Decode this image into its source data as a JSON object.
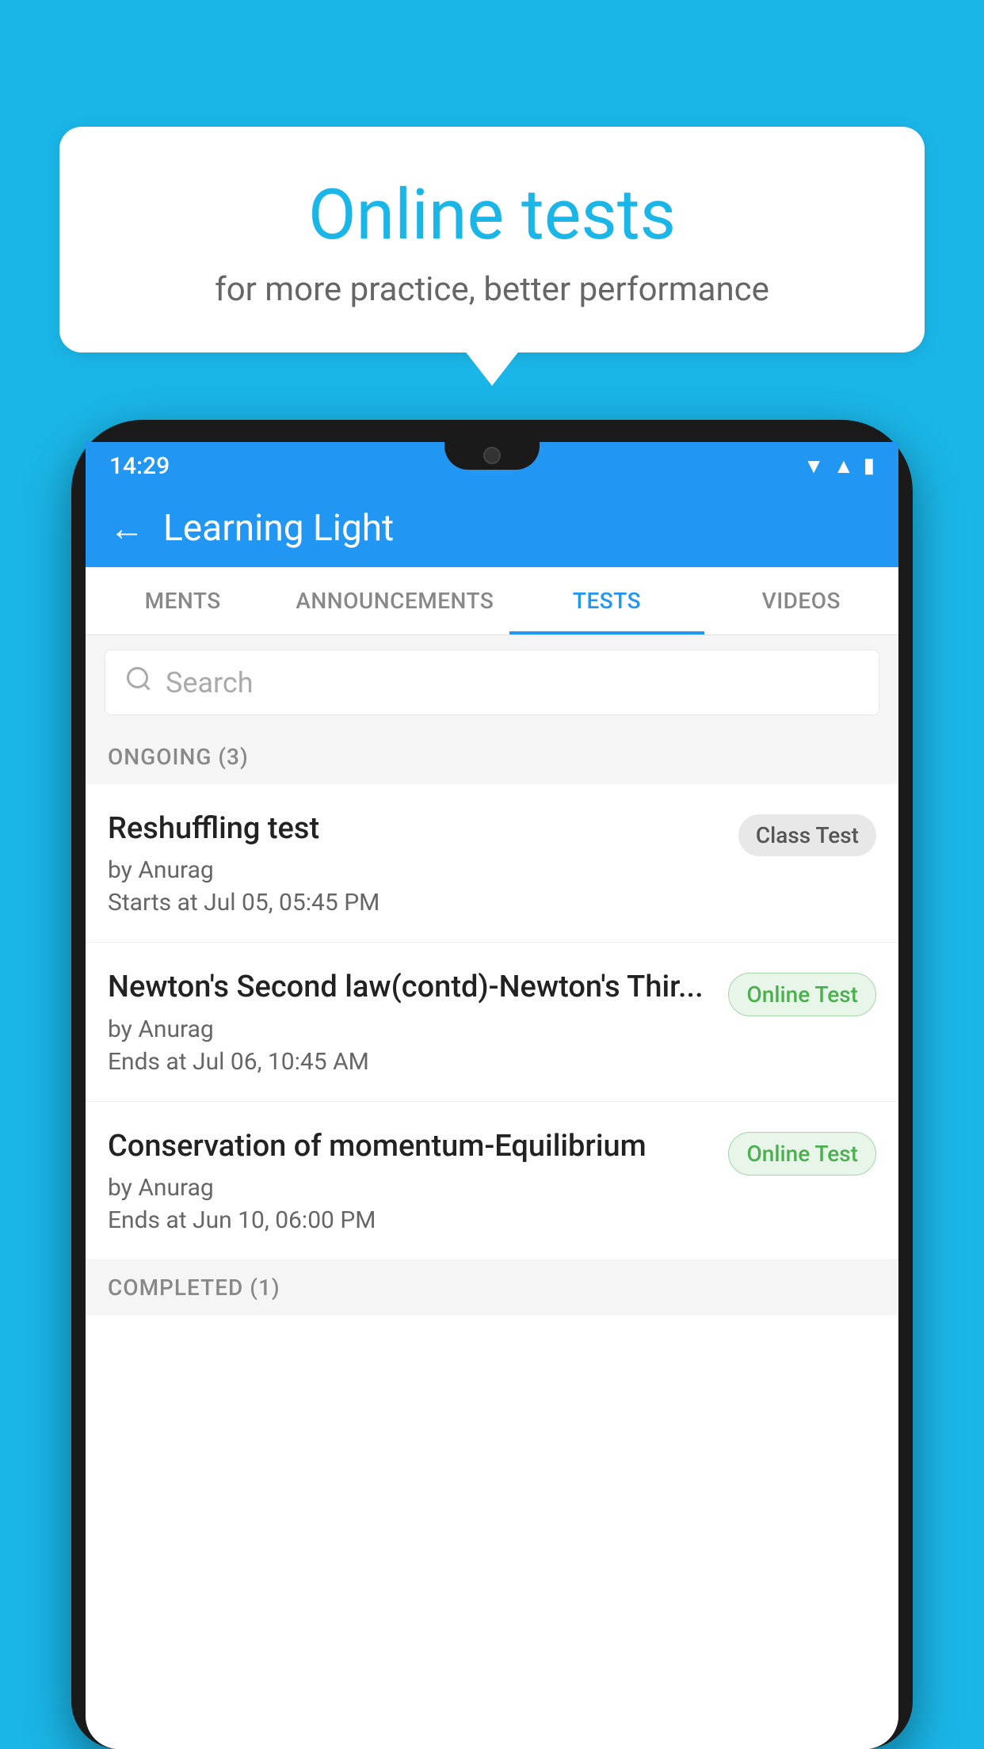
{
  "background_color": "#1ab6e8",
  "speech_bubble": {
    "title": "Online tests",
    "subtitle": "for more practice, better performance"
  },
  "phone": {
    "status_bar": {
      "time": "14:29",
      "icons": [
        "wifi",
        "signal",
        "battery"
      ]
    },
    "header": {
      "title": "Learning Light",
      "back_label": "←"
    },
    "tabs": [
      {
        "label": "MENTS",
        "active": false
      },
      {
        "label": "ANNOUNCEMENTS",
        "active": false
      },
      {
        "label": "TESTS",
        "active": true
      },
      {
        "label": "VIDEOS",
        "active": false
      }
    ],
    "search": {
      "placeholder": "Search"
    },
    "sections": [
      {
        "label": "ONGOING (3)",
        "tests": [
          {
            "name": "Reshuffling test",
            "by": "by Anurag",
            "date": "Starts at  Jul 05, 05:45 PM",
            "badge": "Class Test",
            "badge_type": "class"
          },
          {
            "name": "Newton's Second law(contd)-Newton's Thir...",
            "by": "by Anurag",
            "date": "Ends at  Jul 06, 10:45 AM",
            "badge": "Online Test",
            "badge_type": "online"
          },
          {
            "name": "Conservation of momentum-Equilibrium",
            "by": "by Anurag",
            "date": "Ends at  Jun 10, 06:00 PM",
            "badge": "Online Test",
            "badge_type": "online"
          }
        ]
      }
    ],
    "completed_label": "COMPLETED (1)"
  }
}
